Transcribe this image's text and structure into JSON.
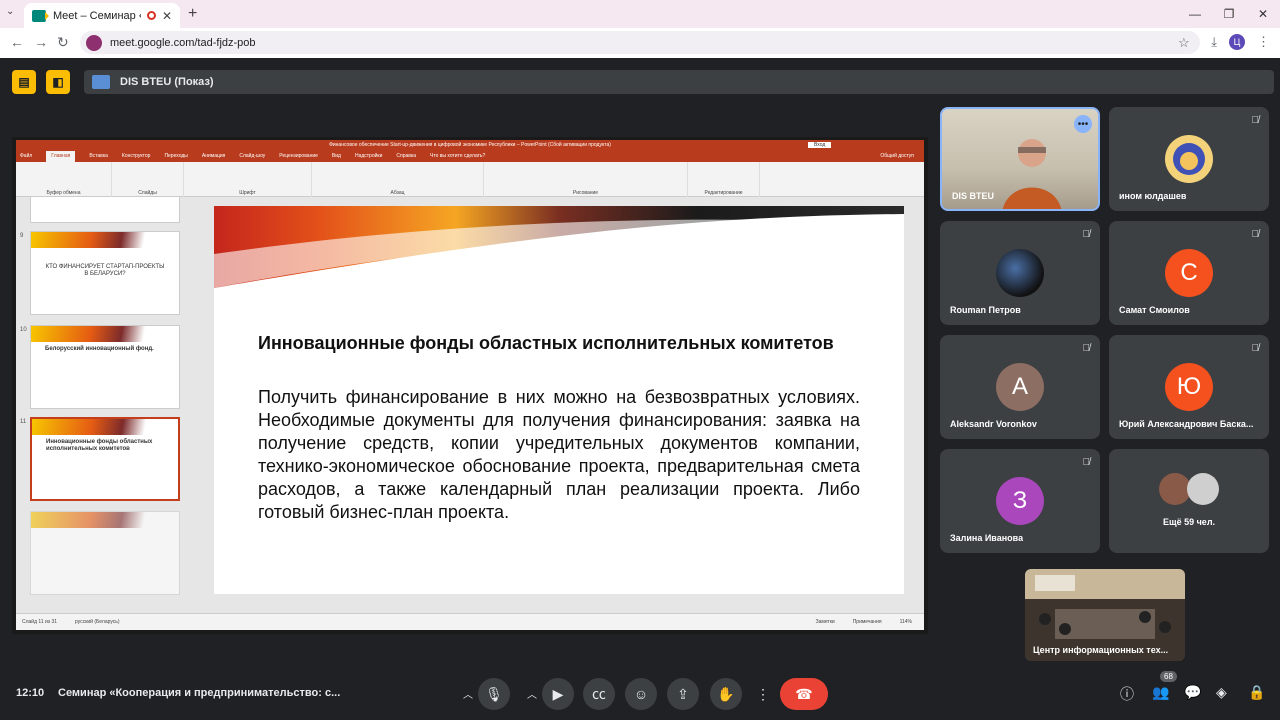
{
  "browser": {
    "tab_title": "Meet – Семинар «Коопера",
    "tab_close": "✕",
    "new_tab": "+",
    "url": "meet.google.com/tad-fjdz-pob",
    "profile_initial": "Ц"
  },
  "meet": {
    "presenter_label": "DIS BTEU (Показ)",
    "time": "12:10",
    "meeting_title": "Семинар «Кооперация и предпринимательство: с...",
    "participant_count": "68",
    "more_participants": "Ещё 59 чел."
  },
  "ppt": {
    "window_title": "Финансовое обеспечение Start-up-движения в цифровой экономике Республики – PowerPoint (Сбой активации продукта)",
    "menu": [
      "Файл",
      "Главная",
      "Вставка",
      "Конструктор",
      "Переходы",
      "Анимация",
      "Слайд-шоу",
      "Рецензирование",
      "Вид",
      "Надстройки",
      "Справка",
      "Что вы хотите сделать?"
    ],
    "sign_in": "Вход",
    "share": "Общий доступ",
    "ribbon_groups": [
      "Буфер обмена",
      "Слайды",
      "Шрифт",
      "Абзац",
      "Рисование",
      "Редактирование"
    ],
    "status_left": "Слайд 11 из 31",
    "status_lang": "русский (Беларусь)",
    "status_notes": "Заметки",
    "status_comments": "Примечания",
    "zoom": "114%"
  },
  "thumbnails": [
    {
      "num": "9",
      "text": "КТО ФИНАНСИРУЕТ СТАРТАП-ПРОЕКТЫ В БЕЛАРУСИ?"
    },
    {
      "num": "10",
      "text": "Белорусский инновационный фонд."
    },
    {
      "num": "11",
      "text": "Инновационные фонды областных исполнительных комитетов"
    }
  ],
  "slide": {
    "heading": "Инновационные фонды областных исполнительных комитетов",
    "body": "Получить финансирование в них можно на безвозвратных условиях. Необходимые документы для получения финансирования: заявка на получение средств, копии учредительных документов компании, технико-экономическое обоснование проекта, предварительная смета расходов, а также календарный план реализации проекта. Либо готовый бизнес-план проекта."
  },
  "participants": [
    {
      "name": "DIS BTEU"
    },
    {
      "name": "ином юлдашев"
    },
    {
      "name": "Rouman Петров"
    },
    {
      "name": "Самат Смоилов",
      "initial": "С",
      "color": "#f4511e"
    },
    {
      "name": "Aleksandr Voronkov",
      "initial": "A",
      "color": "#8d6e63"
    },
    {
      "name": "Юрий Александрович Баска...",
      "initial": "Ю",
      "color": "#f4511e"
    },
    {
      "name": "Залина Иванова",
      "initial": "З",
      "color": "#ab47bc"
    },
    {
      "name": "Центр информационных тех..."
    }
  ],
  "icons": {
    "mic_off": "mic-off-icon",
    "more": "more-vert-icon"
  }
}
